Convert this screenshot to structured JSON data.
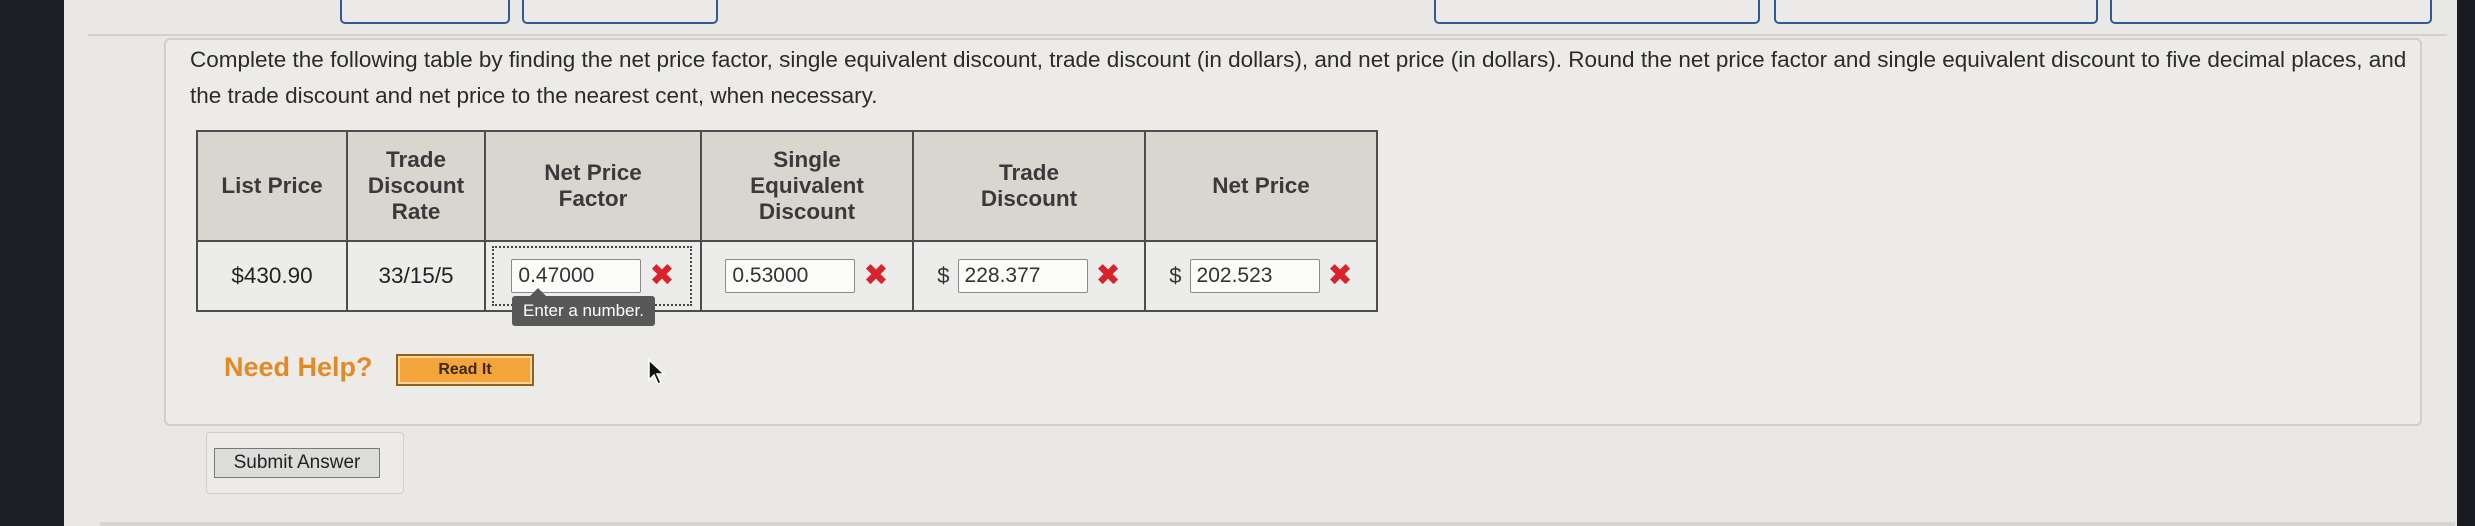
{
  "question": {
    "instructions": "Complete the following table by finding the net price factor, single equivalent discount, trade discount (in dollars), and net price (in dollars). Round the net price factor and single equivalent discount to five decimal places, and the trade discount and net price to the nearest cent, when necessary."
  },
  "table": {
    "headers": {
      "list_price": "List Price",
      "trade_discount_rate": "Trade Discount Rate",
      "net_price_factor": "Net Price Factor",
      "single_equivalent_discount": "Single Equivalent Discount",
      "trade_discount": "Trade Discount",
      "net_price": "Net Price"
    },
    "row": {
      "list_price": "$430.90",
      "trade_discount_rate": "33/15/5",
      "net_price_factor": "0.47000",
      "single_equivalent_discount": "0.53000",
      "trade_discount_prefix": "$",
      "trade_discount": "228.377",
      "net_price_prefix": "$",
      "net_price": "202.523"
    },
    "incorrect_mark": "✖"
  },
  "tooltip": {
    "text": "Enter a number."
  },
  "help": {
    "label": "Need Help?",
    "read_it_label": "Read It"
  },
  "submit": {
    "label": "Submit Answer"
  },
  "colors": {
    "incorrect": "#d9222b",
    "help_orange": "#e28a26",
    "header_bg": "#d9d6d0",
    "tab_border": "#2f5a93"
  }
}
